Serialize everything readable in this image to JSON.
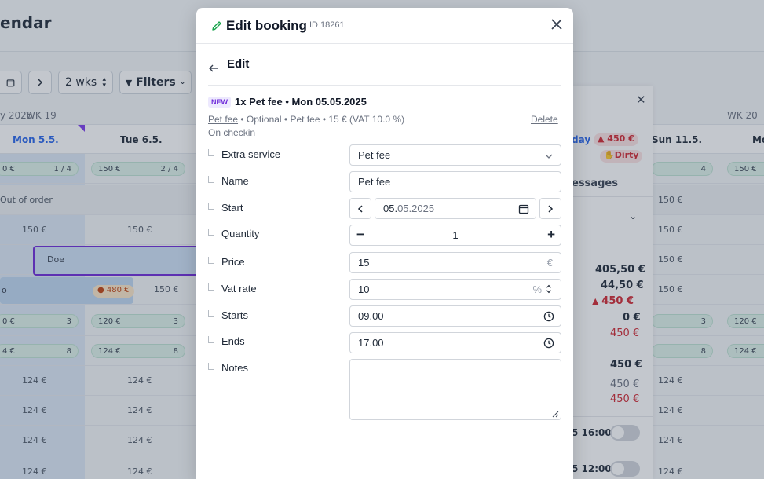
{
  "background": {
    "app_title": "endar",
    "toolbar": {
      "range": "2 wks",
      "filters": "Filters"
    },
    "weeks": [
      "y 2025",
      "WK 19",
      "WK 20"
    ],
    "days": [
      "Mon 5.5.",
      "Tue 6.5.",
      "Sun 11.5.",
      "Mo"
    ],
    "cells": {
      "pill_mon": "0 €",
      "pill_mon_count": "1 / 4",
      "pill_tue": "150 €",
      "pill_tue_count": "2 / 4",
      "pill_sun_count": "4",
      "pill_wk20": "150 €",
      "out_of_order": "Out of order",
      "p150": "150 €",
      "doe": "Doe",
      "o_label": "o",
      "o_badge": "480 €",
      "r3_mon": "0 €",
      "r3_mon_count": "3",
      "r3_tue": "120 €",
      "r3_tue_count": "3",
      "r3_sun_count": "3",
      "r3_wk20": "120 €",
      "r4_mon": "4 €",
      "r4_mon_count": "8",
      "r4_tue": "124 €",
      "r4_tue_count": "8",
      "r4_sun_count": "8",
      "r4_wk20": "124 €",
      "p124": "124 €"
    },
    "side_panel": {
      "day": "day",
      "red_badge": "450 €",
      "dirty": "Dirty",
      "messages": "essages",
      "v1": "405,50 €",
      "v2": "44,50 €",
      "v3": "450 €",
      "v4": "0 €",
      "v5": "450 €",
      "v6": "450 €",
      "v7": "450 €",
      "v8": "450 €",
      "t1": "5 16:00",
      "t2": "5 12:00"
    }
  },
  "modal": {
    "title": "Edit booking",
    "id_label": "ID 18261",
    "subheader": "Edit",
    "item": {
      "badge": "NEW",
      "title": "1x Pet fee • Mon 05.05.2025",
      "link": "Pet fee",
      "meta_rest": " • Optional • Pet fee • 15 € (VAT 10.0 %)",
      "meta2": "On checkin",
      "delete": "Delete"
    },
    "fields": {
      "extra_service": {
        "label": "Extra service",
        "value": "Pet fee"
      },
      "name": {
        "label": "Name",
        "value": "Pet fee"
      },
      "start": {
        "label": "Start",
        "value_day": "05.",
        "value_rest": "05.2025"
      },
      "quantity": {
        "label": "Quantity",
        "value": "1"
      },
      "price": {
        "label": "Price",
        "value": "15",
        "suffix": "€"
      },
      "vat_rate": {
        "label": "Vat rate",
        "value": "10",
        "suffix": "%"
      },
      "starts": {
        "label": "Starts",
        "value": "09.00"
      },
      "ends": {
        "label": "Ends",
        "value": "17.00"
      },
      "notes": {
        "label": "Notes",
        "value": ""
      }
    }
  },
  "colors": {
    "accent": "#6d28d9",
    "danger": "#d1242f",
    "success_pill": "#dff2ea"
  }
}
